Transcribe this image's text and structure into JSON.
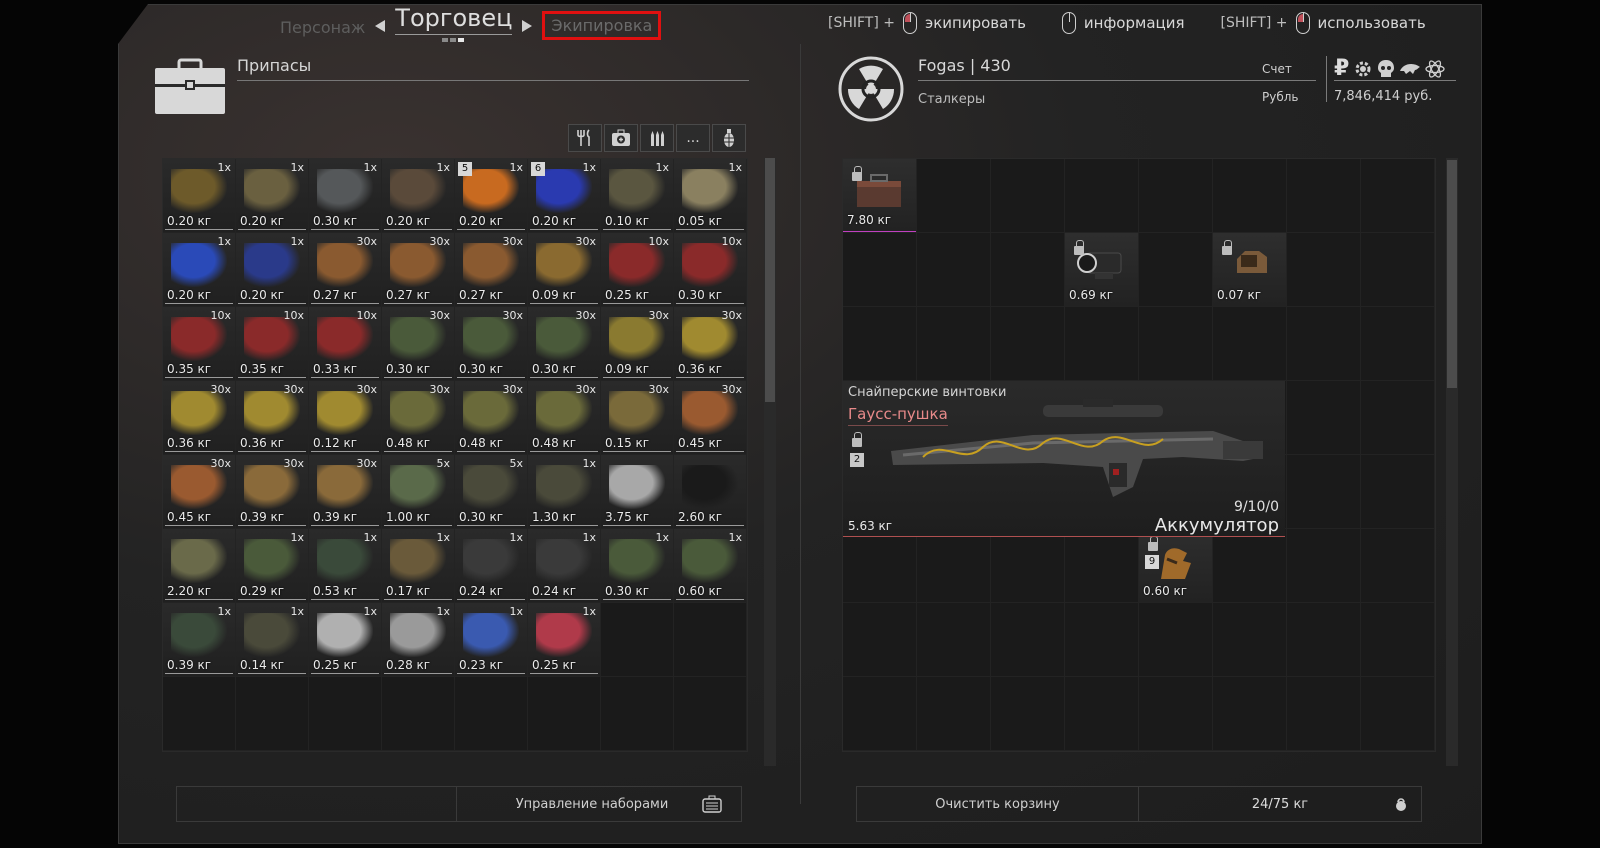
{
  "nav": {
    "left": "Персонаж",
    "current": "Торговец",
    "right": "Экипировка"
  },
  "hints": [
    {
      "modifier": "[SHIFT] +",
      "label": "экипировать"
    },
    {
      "modifier": "",
      "label": "информация"
    },
    {
      "modifier": "[SHIFT] +",
      "label": "использовать"
    }
  ],
  "left": {
    "category": "Припасы",
    "filters": [
      "fork-knife-icon",
      "medkit-icon",
      "ammo-icon",
      "more-icon",
      "grenade-icon"
    ],
    "more_label": "...",
    "sets_label": "Управление наборами"
  },
  "items": [
    {
      "w": "0.20 кг",
      "q": "1x",
      "c": "#6d5a2a"
    },
    {
      "w": "0.20 кг",
      "q": "1x",
      "c": "#6a6040"
    },
    {
      "w": "0.30 кг",
      "q": "1x",
      "c": "#55585a"
    },
    {
      "w": "0.20 кг",
      "q": "1x",
      "c": "#5a4a3a"
    },
    {
      "w": "0.20 кг",
      "q": "1x",
      "c": "#c86a20",
      "b": "5"
    },
    {
      "w": "0.20 кг",
      "q": "1x",
      "c": "#2a3ab0",
      "b": "6"
    },
    {
      "w": "0.10 кг",
      "q": "1x",
      "c": "#5a5640"
    },
    {
      "w": "0.05 кг",
      "q": "1x",
      "c": "#8a8060"
    },
    {
      "w": "0.20 кг",
      "q": "1x",
      "c": "#2a4ab8"
    },
    {
      "w": "0.20 кг",
      "q": "1x",
      "c": "#2a3a8a"
    },
    {
      "w": "0.27 кг",
      "q": "30x",
      "c": "#8a5a30"
    },
    {
      "w": "0.27 кг",
      "q": "30x",
      "c": "#8a5a30"
    },
    {
      "w": "0.27 кг",
      "q": "30x",
      "c": "#8a5a30"
    },
    {
      "w": "0.09 кг",
      "q": "30x",
      "c": "#8a6a30"
    },
    {
      "w": "0.25 кг",
      "q": "10x",
      "c": "#8a2a2a"
    },
    {
      "w": "0.30 кг",
      "q": "10x",
      "c": "#8a2a2a"
    },
    {
      "w": "0.35 кг",
      "q": "10x",
      "c": "#8a2a2a"
    },
    {
      "w": "0.35 кг",
      "q": "10x",
      "c": "#8a2a2a"
    },
    {
      "w": "0.33 кг",
      "q": "10x",
      "c": "#8a2a2a"
    },
    {
      "w": "0.30 кг",
      "q": "30x",
      "c": "#4a5a3a"
    },
    {
      "w": "0.30 кг",
      "q": "30x",
      "c": "#4a5a3a"
    },
    {
      "w": "0.30 кг",
      "q": "30x",
      "c": "#4a5a3a"
    },
    {
      "w": "0.09 кг",
      "q": "30x",
      "c": "#8a7a30"
    },
    {
      "w": "0.36 кг",
      "q": "30x",
      "c": "#a08a30"
    },
    {
      "w": "0.36 кг",
      "q": "30x",
      "c": "#a08a30"
    },
    {
      "w": "0.36 кг",
      "q": "30x",
      "c": "#a08a30"
    },
    {
      "w": "0.12 кг",
      "q": "30x",
      "c": "#a08a30"
    },
    {
      "w": "0.48 кг",
      "q": "30x",
      "c": "#6a6a3a"
    },
    {
      "w": "0.48 кг",
      "q": "30x",
      "c": "#6a6a3a"
    },
    {
      "w": "0.48 кг",
      "q": "30x",
      "c": "#6a6a3a"
    },
    {
      "w": "0.15 кг",
      "q": "30x",
      "c": "#7a6a3a"
    },
    {
      "w": "0.45 кг",
      "q": "30x",
      "c": "#9a5a30"
    },
    {
      "w": "0.45 кг",
      "q": "30x",
      "c": "#9a5a30"
    },
    {
      "w": "0.39 кг",
      "q": "30x",
      "c": "#8a6a3a"
    },
    {
      "w": "0.39 кг",
      "q": "30x",
      "c": "#8a6a3a"
    },
    {
      "w": "1.00 кг",
      "q": "5x",
      "c": "#5a6a4a"
    },
    {
      "w": "0.30 кг",
      "q": "5x",
      "c": "#4a4a3a"
    },
    {
      "w": "1.30 кг",
      "q": "1x",
      "c": "#4a4a3a"
    },
    {
      "w": "3.75 кг",
      "q": "",
      "c": "#a8a8a8"
    },
    {
      "w": "2.60 кг",
      "q": "",
      "c": "#1a1a1a"
    },
    {
      "w": "2.20 кг",
      "q": "",
      "c": "#6a6a4a"
    },
    {
      "w": "0.29 кг",
      "q": "1x",
      "c": "#4a5a3a"
    },
    {
      "w": "0.53 кг",
      "q": "1x",
      "c": "#3a4a3a"
    },
    {
      "w": "0.17 кг",
      "q": "1x",
      "c": "#6a5a3a"
    },
    {
      "w": "0.24 кг",
      "q": "1x",
      "c": "#3a3a3a"
    },
    {
      "w": "0.24 кг",
      "q": "1x",
      "c": "#3a3a3a"
    },
    {
      "w": "0.30 кг",
      "q": "1x",
      "c": "#4a5a3a"
    },
    {
      "w": "0.60 кг",
      "q": "1x",
      "c": "#4a5a3a"
    },
    {
      "w": "0.39 кг",
      "q": "1x",
      "c": "#3a4a3a"
    },
    {
      "w": "0.14 кг",
      "q": "1x",
      "c": "#4a4a3a"
    },
    {
      "w": "0.25 кг",
      "q": "1x",
      "c": "#b0b0b0"
    },
    {
      "w": "0.28 кг",
      "q": "1x",
      "c": "#9a9a9a"
    },
    {
      "w": "0.23 кг",
      "q": "1x",
      "c": "#3a5ab0"
    },
    {
      "w": "0.25 кг",
      "q": "1x",
      "c": "#b03a4a"
    }
  ],
  "trader": {
    "name": "Fogas",
    "sep": "|",
    "level": "430",
    "faction": "Сталкеры",
    "account_label": "Счет",
    "currency_label": "Рубль",
    "ruble_sign": "₽",
    "money": "7,846,414 руб."
  },
  "equip": {
    "box": {
      "w": "7.80 кг"
    },
    "scope": {
      "w": "0.69 кг"
    },
    "sight": {
      "w": "0.07 кг"
    },
    "glove": {
      "w": "0.60 кг",
      "b": "9"
    },
    "weapon": {
      "category": "Снайперские винтовки",
      "name": "Гаусс-пушка",
      "badge": "2",
      "ammo": "9/10/0",
      "ammo_type": "Аккумулятор",
      "w": "5.63 кг"
    }
  },
  "cart": {
    "clear_label": "Очистить корзину",
    "weight": "24/75 кг"
  }
}
